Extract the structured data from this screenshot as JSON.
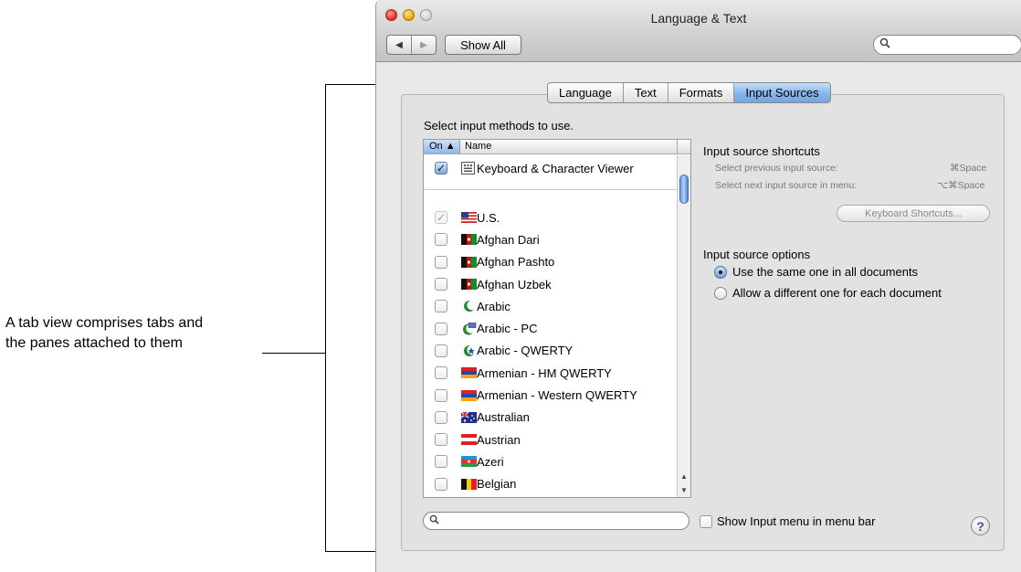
{
  "annotation": {
    "line1": "A tab view comprises tabs and",
    "line2": "the panes attached to them"
  },
  "window": {
    "title": "Language & Text",
    "nav_back": "◀",
    "nav_forward": "▶",
    "show_all": "Show All",
    "search_placeholder": ""
  },
  "tabs": [
    {
      "label": "Language",
      "active": false
    },
    {
      "label": "Text",
      "active": false
    },
    {
      "label": "Formats",
      "active": false
    },
    {
      "label": "Input Sources",
      "active": true
    }
  ],
  "pane": {
    "instruction": "Select input methods to use.",
    "list": {
      "col_on": "On ▲",
      "col_name": "Name",
      "fixed_item": {
        "label": "Keyboard & Character Viewer",
        "checked": true,
        "icon": "keyboard-viewer-icon"
      },
      "items": [
        {
          "label": "U.S.",
          "state": "checked-dim",
          "icon": "us-flag"
        },
        {
          "label": "Afghan Dari",
          "state": "unchecked",
          "icon": "afghan-flag"
        },
        {
          "label": "Afghan Pashto",
          "state": "unchecked",
          "icon": "afghan-flag"
        },
        {
          "label": "Afghan Uzbek",
          "state": "unchecked",
          "icon": "afghan-flag"
        },
        {
          "label": "Arabic",
          "state": "unchecked",
          "icon": "crescent-green"
        },
        {
          "label": "Arabic - PC",
          "state": "unchecked",
          "icon": "crescent-pc"
        },
        {
          "label": "Arabic - QWERTY",
          "state": "unchecked",
          "icon": "crescent-qwerty"
        },
        {
          "label": "Armenian - HM QWERTY",
          "state": "unchecked",
          "icon": "armenian-flag"
        },
        {
          "label": "Armenian - Western QWERTY",
          "state": "unchecked",
          "icon": "armenian-flag"
        },
        {
          "label": "Australian",
          "state": "unchecked",
          "icon": "australian-flag"
        },
        {
          "label": "Austrian",
          "state": "unchecked",
          "icon": "austrian-flag"
        },
        {
          "label": "Azeri",
          "state": "unchecked",
          "icon": "azeri-flag"
        },
        {
          "label": "Belgian",
          "state": "unchecked",
          "icon": "belgian-flag"
        }
      ]
    },
    "shortcuts": {
      "heading": "Input source shortcuts",
      "prev_label": "Select previous input source:",
      "prev_key": "⌘Space",
      "next_label": "Select next input source in menu:",
      "next_key": "⌥⌘Space",
      "button": "Keyboard Shortcuts..."
    },
    "options": {
      "heading": "Input source options",
      "radios": [
        {
          "label": "Use the same one in all documents",
          "selected": true
        },
        {
          "label": "Allow a different one for each document",
          "selected": false
        }
      ]
    },
    "bottom": {
      "search_placeholder": "",
      "show_menu_label": "Show Input menu in menu bar",
      "help": "?"
    }
  },
  "colors": {
    "tab_active": "#86b5ea",
    "window_bg": "#e8e8e8",
    "pane_bg": "#e2e2e2"
  }
}
